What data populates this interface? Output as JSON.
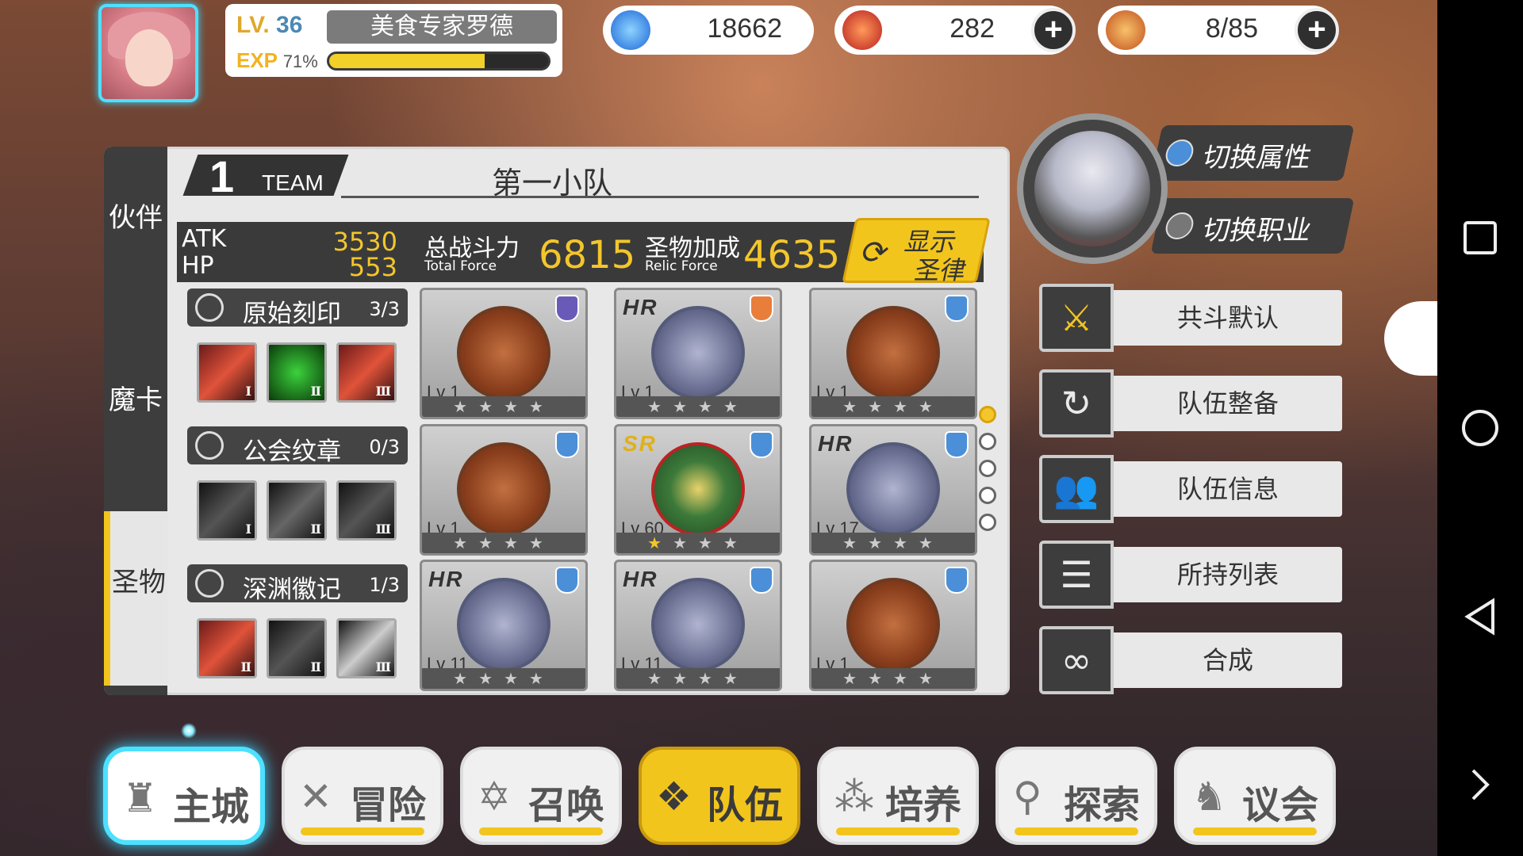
{
  "player": {
    "level_prefix": "LV.",
    "level": "36",
    "name": "美食专家罗德",
    "exp_label": "EXP",
    "exp_pct_label": "71%",
    "exp_fraction": 0.71
  },
  "resources": [
    {
      "name": "crystal",
      "value": "18662",
      "icon": "blue-flame-icon"
    },
    {
      "name": "gems",
      "value": "282",
      "icon": "red-gem-icon"
    },
    {
      "name": "stamina",
      "value": "8/85",
      "icon": "hotdog-icon"
    }
  ],
  "side_tabs": [
    "伙伴",
    "魔卡",
    "圣物"
  ],
  "team": {
    "number": "1",
    "word": "TEAM",
    "name": "第一小队"
  },
  "stats": {
    "atk_label": "ATK",
    "atk": "3530",
    "hp_label": "HP",
    "hp": "553",
    "force_label": "总战斗力",
    "force_sub": "Total Force",
    "force": "6815",
    "relic_label": "圣物加成",
    "relic_sub": "Relic Force",
    "relic": "4635",
    "relic_button": [
      "显示",
      "圣律"
    ]
  },
  "groups": [
    {
      "name": "原始刻印",
      "count": "3/3",
      "slots": [
        "Ⅰ",
        "Ⅱ",
        "Ⅲ"
      ]
    },
    {
      "name": "公会纹章",
      "count": "0/3",
      "slots": [
        "Ⅰ",
        "Ⅱ",
        "Ⅲ"
      ]
    },
    {
      "name": "深渊徽记",
      "count": "1/3",
      "slots": [
        "Ⅱ",
        "Ⅱ",
        "Ⅲ"
      ]
    }
  ],
  "cards": [
    {
      "lv": "Lv 1",
      "rarity": "",
      "stars": 0
    },
    {
      "lv": "Lv 1",
      "rarity": "HR",
      "stars": 0
    },
    {
      "lv": "Lv 1",
      "rarity": "",
      "stars": 0
    },
    {
      "lv": "Lv 1",
      "rarity": "",
      "stars": 0
    },
    {
      "lv": "Lv 60",
      "rarity": "SR",
      "stars": 1
    },
    {
      "lv": "Lv 17",
      "rarity": "HR",
      "stars": 0
    },
    {
      "lv": "Lv 11",
      "rarity": "HR",
      "stars": 0
    },
    {
      "lv": "Lv 11",
      "rarity": "HR",
      "stars": 0
    },
    {
      "lv": "Lv 1",
      "rarity": "",
      "stars": 0
    }
  ],
  "switch_buttons": [
    "切换属性",
    "切换职业"
  ],
  "menu": [
    "共斗默认",
    "队伍整备",
    "队伍信息",
    "所持列表",
    "合成"
  ],
  "bottom_nav": [
    "主城",
    "冒险",
    "召唤",
    "队伍",
    "培养",
    "探索",
    "议会"
  ],
  "colors": {
    "accent": "#f2c51d",
    "highlight": "#4ee0ff",
    "dark": "#3d3d3d"
  }
}
